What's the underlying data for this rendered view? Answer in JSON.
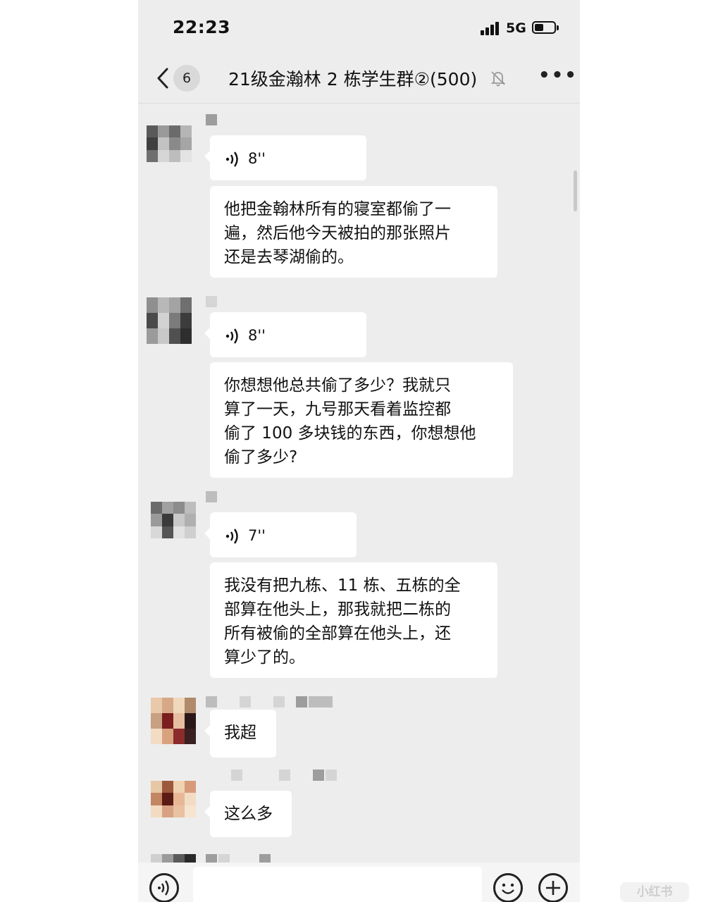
{
  "status_bar": {
    "time": "22:23",
    "network": "5G"
  },
  "nav": {
    "back_icon": "chevron-left-icon",
    "unread_count": "6",
    "title": "21级金瀚林 2 栋学生群②(500)",
    "mute_icon": "bell-off-icon",
    "more_icon": "more-icon"
  },
  "messages": [
    {
      "type": "voice",
      "duration": "8''"
    },
    {
      "type": "text",
      "lines": [
        "他把金翰林所有的寝室都偷了一",
        "遍，然后他今天被拍的那张照片",
        "还是去琴湖偷的。"
      ]
    },
    {
      "type": "voice",
      "duration": "8''"
    },
    {
      "type": "text",
      "lines": [
        "你想想他总共偷了多少？我就只",
        "算了一天，九号那天看着监控都",
        "偷了 100 多块钱的东西，你想想他",
        "偷了多少?"
      ]
    },
    {
      "type": "voice",
      "duration": "7''"
    },
    {
      "type": "text",
      "lines": [
        "我没有把九栋、11 栋、五栋的全",
        "部算在他头上，那我就把二栋的",
        "所有被偷的全部算在他头上，还",
        "算少了的。"
      ]
    },
    {
      "type": "text",
      "lines": [
        "我超"
      ]
    },
    {
      "type": "text",
      "lines": [
        "这么多"
      ]
    }
  ],
  "input_bar": {
    "voice_icon": "voice-icon",
    "emoji_icon": "emoji-icon",
    "plus_icon": "plus-icon",
    "placeholder": ""
  },
  "watermark": {
    "logo": "xiaohongshu-watermark",
    "text": "小红书"
  }
}
